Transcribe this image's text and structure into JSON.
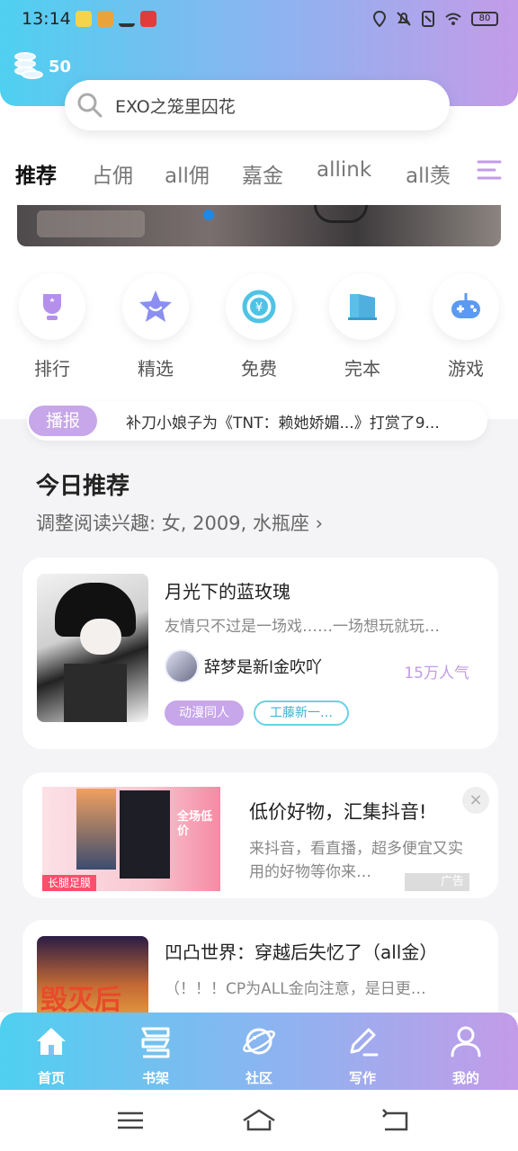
{
  "status": {
    "time": "13:14",
    "battery": "80"
  },
  "header": {
    "coins": "50"
  },
  "search": {
    "text": "EXO之笼里囚花"
  },
  "tabs": [
    "推荐",
    "占佣",
    "all佣",
    "嘉金",
    "allink",
    "all羡"
  ],
  "quick": [
    {
      "label": "排行",
      "icon": "trophy-icon"
    },
    {
      "label": "精选",
      "icon": "star-icon"
    },
    {
      "label": "免费",
      "icon": "free-yen-icon"
    },
    {
      "label": "完本",
      "icon": "book-icon"
    },
    {
      "label": "游戏",
      "icon": "gamepad-icon"
    }
  ],
  "announce": {
    "badge": "播报",
    "text": "补刀小娘子为《TNT：赖她娇媚...》打赏了9..."
  },
  "section": {
    "title": "今日推荐",
    "subtitle": "调整阅读兴趣: 女, 2009, 水瓶座 ›"
  },
  "book1": {
    "title": "月光下的蓝玫瑰",
    "desc": "友情只不过是一场戏……一场想玩就玩…",
    "author": "辞梦是新l金吹吖",
    "popularity": "15万人气",
    "tag1": "动漫同人",
    "tag2": "工藤新一…"
  },
  "ad": {
    "title": "低价好物，汇集抖音!",
    "desc": "来抖音，看直播，超多便宜又实用的好物等你来…",
    "tag": "广告",
    "img_text": "全场低价",
    "img_sub": "长腿足膜"
  },
  "book2": {
    "title": "凹凸世界：穿越后失忆了（all金）",
    "desc": "（！！！CP为ALL金向注意，是日更…",
    "cover_text": "毁灭后"
  },
  "nav": [
    "首页",
    "书架",
    "社区",
    "写作",
    "我的"
  ],
  "colors": {
    "accent": "#c39be8",
    "cyan": "#4fd0f0"
  }
}
